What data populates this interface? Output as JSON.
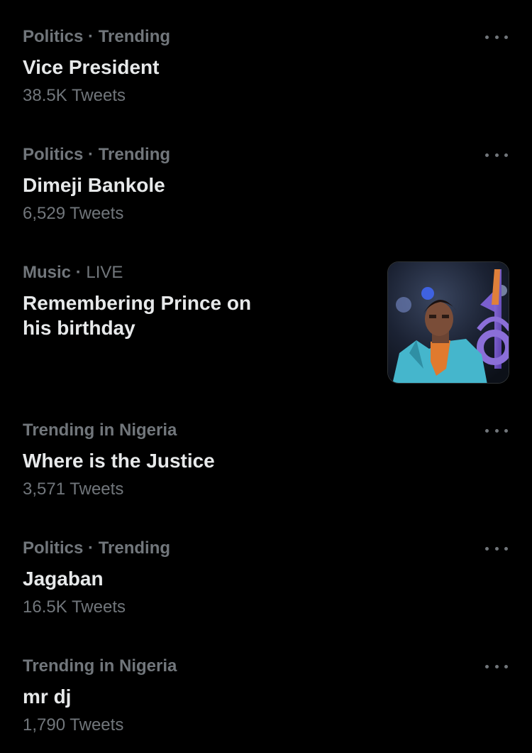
{
  "trends": [
    {
      "category": "Politics",
      "separator": "·",
      "status": "Trending",
      "name": "Vice President",
      "count": "38.5K Tweets"
    },
    {
      "category": "Politics",
      "separator": "·",
      "status": "Trending",
      "name": "Dimeji Bankole",
      "count": "6,529 Tweets"
    },
    {
      "category": "Music",
      "separator": "·",
      "status": "LIVE",
      "name": "Remembering Prince on his birthday",
      "thumbnail_icon": "prince-performer-photo"
    },
    {
      "category": "Trending in Nigeria",
      "name": "Where is the Justice",
      "count": "3,571 Tweets"
    },
    {
      "category": "Politics",
      "separator": "·",
      "status": "Trending",
      "name": "Jagaban",
      "count": "16.5K Tweets"
    },
    {
      "category": "Trending in Nigeria",
      "name": "mr dj",
      "count": "1,790 Tweets"
    }
  ],
  "more_icon": "more-horizontal-icon",
  "colors": {
    "background": "#000000",
    "primary_text": "#e7e9ea",
    "secondary_text": "#71767b"
  }
}
